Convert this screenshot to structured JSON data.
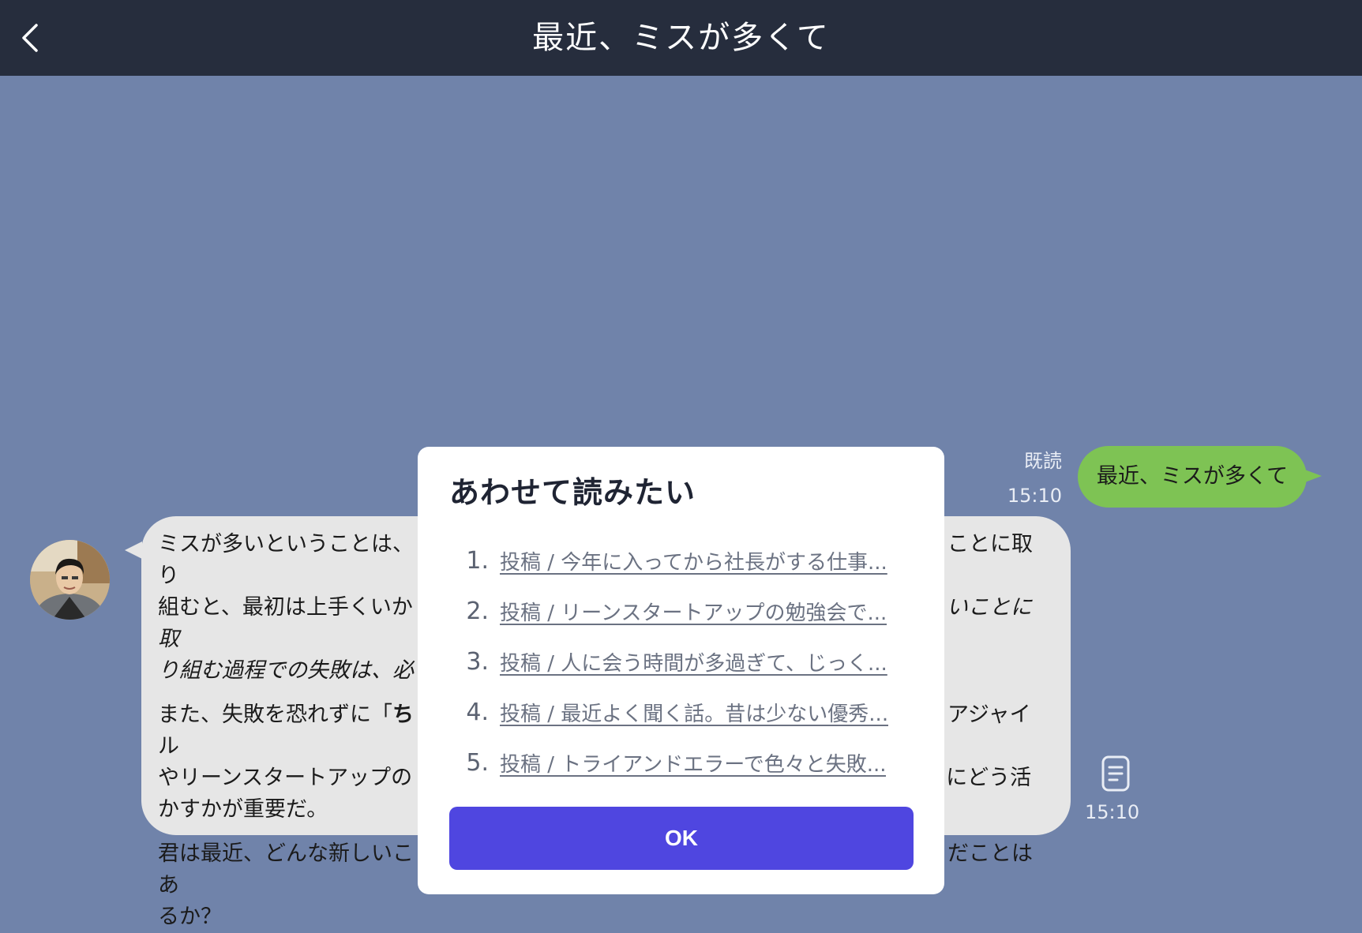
{
  "header": {
    "title": "最近、ミスが多くて",
    "back_icon": "chevron-left-icon"
  },
  "messages": {
    "outgoing": {
      "read_label": "既読",
      "time": "15:10",
      "text": "最近、ミスが多くて",
      "color": "#7ec354"
    },
    "incoming": {
      "para1_a": "ミスが多いということは、",
      "para1_b": "ことに取り",
      "para1_c": "組むと、最初は上手くいか",
      "para1_d": "いことに取",
      "para1_e": "り組む過程での失敗は、必",
      "para2_a": "また、失敗を恐れずに「",
      "para2_b": "ち",
      "para2_c": "アジャイル",
      "para2_d": "やリーンスタートアップの",
      "para2_e": "にどう活",
      "para2_f": "かすかが重要だ。",
      "para3_a": "君は最近、どんな新しいこ",
      "para3_b": "だことはあ",
      "para3_c": "るか？",
      "time": "15:10",
      "doc_icon": "document-icon",
      "color": "#e6e6e6"
    }
  },
  "modal": {
    "title": "あわせて読みたい",
    "items": [
      {
        "num": "1.",
        "label": "投稿 / 今年に入ってから社長がする仕事..."
      },
      {
        "num": "2.",
        "label": "投稿 / リーンスタートアップの勉強会で..."
      },
      {
        "num": "3.",
        "label": "投稿 / 人に会う時間が多過ぎて、じっく..."
      },
      {
        "num": "4.",
        "label": "投稿 / 最近よく聞く話。昔は少ない優秀..."
      },
      {
        "num": "5.",
        "label": "投稿 / トライアンドエラーで色々と失敗..."
      }
    ],
    "ok_label": "OK",
    "ok_color": "#4f46e0"
  }
}
